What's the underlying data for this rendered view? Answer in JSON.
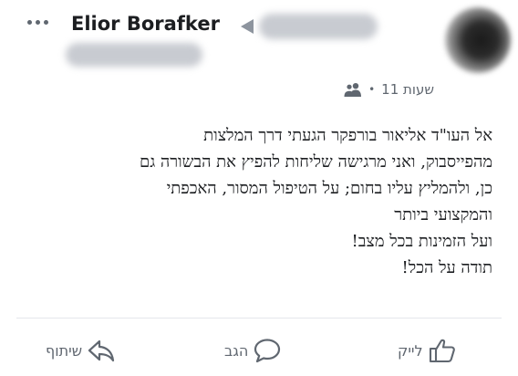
{
  "post": {
    "author_name": "Elior Borafker",
    "time": "11 שעות",
    "separator": "•",
    "audience_icon": "friends-icon",
    "text_lines": [
      "אל העו\"ד אליאור בורפקר הגעתי דרך המלצות",
      "מהפייסבוק, ואני מרגישה שליחות להפיץ את הבשורה גם",
      "כן, ולהמליץ עליו בחום; על הטיפול המסור, האכפתי",
      "והמקצועי ביותר",
      "ועל הזמינות בכל מצב!",
      "תודה על הכל!"
    ]
  },
  "actions": {
    "like_label": "לייק",
    "comment_label": "הגב",
    "share_label": "שיתוף"
  },
  "icons": {
    "more": "more-options-icon",
    "arrow": "share-arrow-icon",
    "like": "thumbs-up-icon",
    "comment": "speech-bubble-icon",
    "share": "share-arrow-icon"
  },
  "colors": {
    "text": "#1c1e21",
    "secondary": "#606770",
    "background": "#ffffff"
  }
}
